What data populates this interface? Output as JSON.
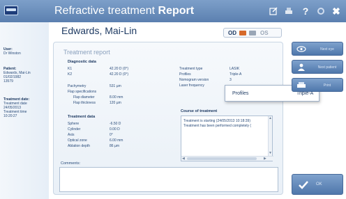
{
  "window": {
    "title_prefix": "Refractive treatment",
    "title_bold": "Report",
    "icons": [
      "edit-icon",
      "print-icon",
      "help-icon",
      "settings-icon",
      "close-icon"
    ],
    "help_glyph": "?",
    "close_glyph": "✖"
  },
  "sidebar": {
    "user_label": "User:",
    "user_name": "Dr Winston",
    "patient_label": "Patient:",
    "patient_name": "Edwards, Mai-Lin",
    "patient_dob": "01/02/1982",
    "patient_id": "13579",
    "treatment_date_label": "Treatment date:",
    "treatment_date_sublabel": "Treatment date",
    "treatment_date": "24/05/2013",
    "treatment_time_label": "Treatment time",
    "treatment_time": "10:20:27"
  },
  "header": {
    "patient_name": "Edwards, Mai-Lin",
    "eye_od": "OD",
    "eye_os": "OS"
  },
  "report": {
    "title": "Treatment report",
    "diagnostic": {
      "heading": "Diagnostic data",
      "rows": [
        {
          "label": "K1",
          "value": "42.20 D (0°)"
        },
        {
          "label": "K2",
          "value": "42.20 D (0°)"
        },
        {
          "label": "Pachymetry",
          "value": "531 µm"
        },
        {
          "label": "Flap specifications",
          "value": ""
        },
        {
          "label": "Flap diameter",
          "value": "8.00 mm"
        },
        {
          "label": "Flap thickness",
          "value": "120 µm"
        }
      ]
    },
    "treatment": {
      "heading": "Treatment data",
      "rows": [
        {
          "label": "Sphere",
          "value": "-6.50 D"
        },
        {
          "label": "Cylinder",
          "value": "0.00 D"
        },
        {
          "label": "Axis",
          "value": "0°"
        },
        {
          "label": "Optical zone",
          "value": "6.00 mm"
        },
        {
          "label": "Ablation depth",
          "value": "86 µm"
        }
      ]
    },
    "info": {
      "rows": [
        {
          "label": "Treatment type",
          "value": "LASIK"
        },
        {
          "label": "Profiles",
          "value": "Triple-A"
        },
        {
          "label": "Nomogram version",
          "value": "3"
        },
        {
          "label": "Laser frequency",
          "value": ""
        }
      ]
    },
    "course": {
      "heading": "Course of treatment",
      "lines": [
        "Treatment is starting (24/05/2013 10:18:39)",
        "Treatment has been performed completely ("
      ]
    },
    "comments_label": "Comments:"
  },
  "popup": {
    "label": "Profiles",
    "value": "Triple-A"
  },
  "buttons": {
    "next_eye": "Next eye",
    "next_patient": "Next patient",
    "print": "Print",
    "ok": "OK"
  },
  "colors": {
    "titlebar": "#5b80b0",
    "accent": "#1f3b63",
    "button": "#4f77ab",
    "od_indicator": "#d66a2b"
  }
}
